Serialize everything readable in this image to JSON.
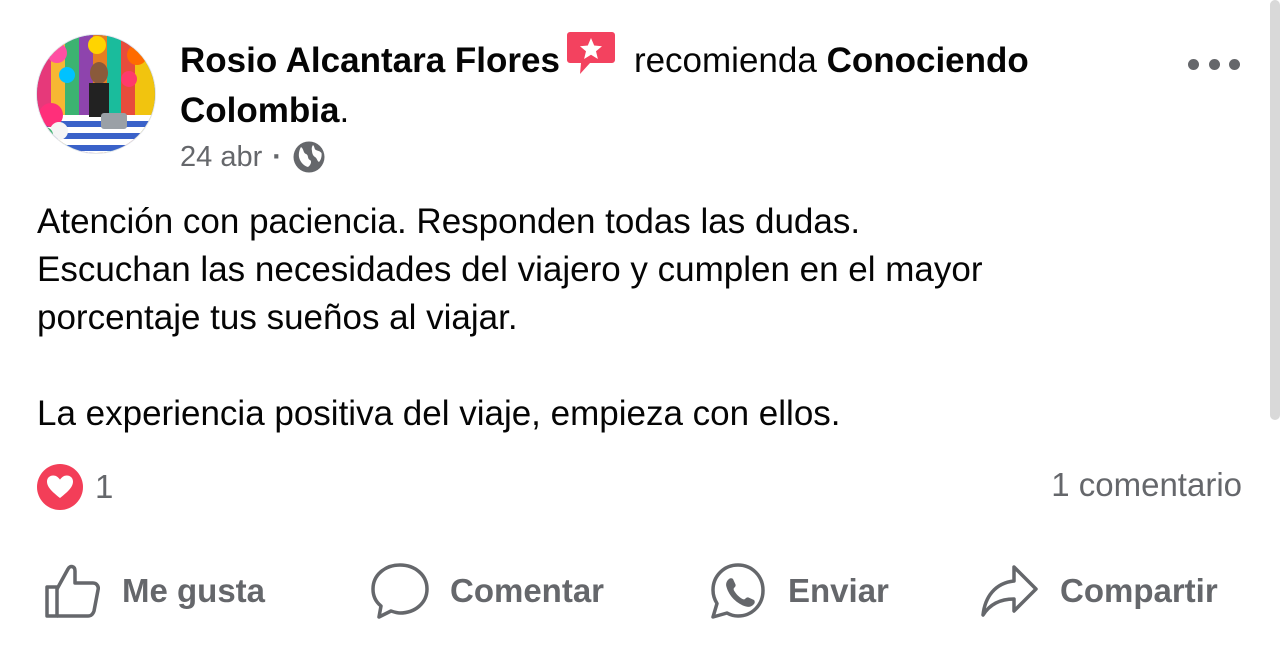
{
  "post": {
    "author": "Rosio Alcantara Flores",
    "recommends_text": "recomienda",
    "page_name": "Conociendo Colombia",
    "page_suffix": ".",
    "date": "24 abr",
    "dot": "·",
    "privacy_icon": "globe-icon",
    "body": {
      "line1": "Atención con paciencia. Responden todas las dudas.",
      "line2": "Escuchan las necesidades del viajero y cumplen en el mayor",
      "line3": "porcentaje tus sueños al viajar.",
      "para2": "La experiencia positiva del viaje, empieza con ellos."
    },
    "reactions": {
      "icon": "heart-icon",
      "count": "1"
    },
    "comments_count": "1 comentario"
  },
  "actions": {
    "like": "Me gusta",
    "comment": "Comentar",
    "send": "Enviar",
    "share": "Compartir"
  },
  "colors": {
    "secondary_text": "#65676b",
    "heart": "#f33e58",
    "recommend_badge": "#f3425f"
  }
}
